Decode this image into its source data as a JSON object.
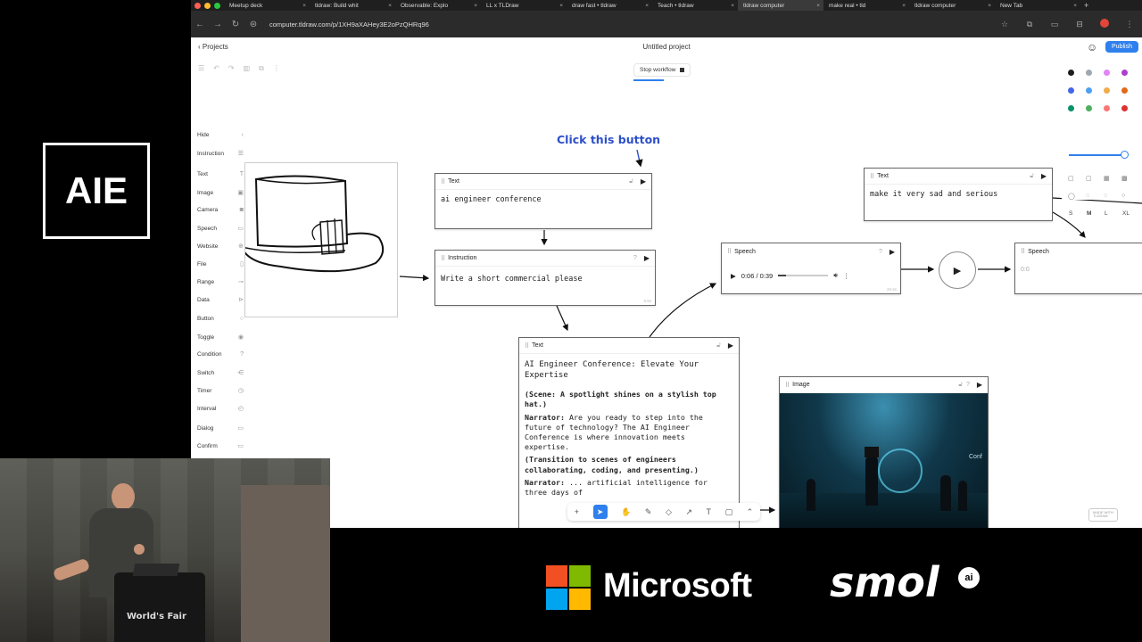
{
  "browser": {
    "tabs": [
      {
        "label": "Meetup deck",
        "active": false
      },
      {
        "label": "tldraw: Build whit",
        "active": false
      },
      {
        "label": "Observable: Explo",
        "active": false
      },
      {
        "label": "LL x TLDraw",
        "active": false
      },
      {
        "label": "draw fast • tldraw",
        "active": false
      },
      {
        "label": "Teach • tldraw",
        "active": false
      },
      {
        "label": "tldraw computer",
        "active": true
      },
      {
        "label": "make real • tld",
        "active": false
      },
      {
        "label": "tldraw computer",
        "active": false
      },
      {
        "label": "New Tab",
        "active": false
      }
    ],
    "new_tab_symbol": "+",
    "url": "computer.tldraw.com/p/1XH9aXAHey3E2oPzQHRq96"
  },
  "app": {
    "projects_label": "Projects",
    "title": "Untitled project",
    "publish_label": "Publish",
    "stop_workflow_label": "Stop workflow"
  },
  "sidebar": {
    "hide_label": "Hide",
    "items": [
      {
        "label": "Instruction",
        "icon": "list-icon",
        "glyph": "☰"
      },
      {
        "label": "Text",
        "icon": "text-icon",
        "glyph": "T"
      },
      {
        "label": "Image",
        "icon": "image-icon",
        "glyph": "▣"
      },
      {
        "label": "Camera",
        "icon": "camera-icon",
        "glyph": "◙"
      },
      {
        "label": "Speech",
        "icon": "speech-icon",
        "glyph": "▭"
      },
      {
        "label": "Website",
        "icon": "globe-icon",
        "glyph": "⊕"
      },
      {
        "label": "File",
        "icon": "file-icon",
        "glyph": "▯"
      },
      {
        "label": "Range",
        "icon": "range-icon",
        "glyph": "⊸"
      },
      {
        "label": "Data",
        "icon": "data-icon",
        "glyph": "⊳"
      },
      {
        "label": "Button",
        "icon": "button-icon",
        "glyph": "○"
      },
      {
        "label": "Toggle",
        "icon": "toggle-icon",
        "glyph": "◉"
      },
      {
        "label": "Condition",
        "icon": "condition-icon",
        "glyph": "?"
      },
      {
        "label": "Switch",
        "icon": "switch-icon",
        "glyph": "⋲"
      },
      {
        "label": "Timer",
        "icon": "timer-icon",
        "glyph": "◷"
      },
      {
        "label": "Interval",
        "icon": "interval-icon",
        "glyph": "◴"
      },
      {
        "label": "Dialog",
        "icon": "dialog-icon",
        "glyph": "▭"
      },
      {
        "label": "Confirm",
        "icon": "confirm-icon",
        "glyph": "▭"
      }
    ]
  },
  "canvas": {
    "annotation": "Click this button",
    "node_text_1": {
      "type": "Text",
      "content": "ai engineer conference"
    },
    "node_instruction": {
      "type": "Instruction",
      "content": "Write a short commercial please",
      "timing": "0.6s"
    },
    "node_text_output": {
      "type": "Text",
      "heading": "AI Engineer Conference: Elevate Your Expertise",
      "lines": [
        {
          "bold": "(Scene: A spotlight shines on a stylish top hat.)",
          "rest": ""
        },
        {
          "bold": "Narrator:",
          "rest": " Are you ready to step into the future of technology? The AI Engineer Conference is where innovation meets expertise."
        },
        {
          "bold": "(Transition to scenes of engineers collaborating, coding, and presenting.)",
          "rest": ""
        },
        {
          "bold": "Narrator:",
          "rest": " ... artificial intelligence for three days of"
        }
      ]
    },
    "node_speech_1": {
      "type": "Speech",
      "time": "0:06 / 0:39",
      "timing": "26.6s",
      "progress": 0.15
    },
    "node_text_2": {
      "type": "Text",
      "content": "make it very sad and serious"
    },
    "node_speech_2": {
      "type": "Speech",
      "time": "0:0"
    },
    "node_image": {
      "type": "Image",
      "image_text": "Conf"
    }
  },
  "style_panel": {
    "colors": [
      "#1d1d1d",
      "#9fa8b2",
      "#e085f4",
      "#ae3ec9",
      "#4465e9",
      "#4ba1f1",
      "#f1ac4b",
      "#e16919",
      "#099268",
      "#4cb05e",
      "#f87777",
      "#e03131"
    ],
    "sizes": [
      "S",
      "M",
      "L",
      "XL"
    ],
    "selected_size": "M"
  },
  "bottom_toolbar": {
    "tools": [
      {
        "name": "add-tool",
        "glyph": "+"
      },
      {
        "name": "select-tool",
        "glyph": "➤"
      },
      {
        "name": "hand-tool",
        "glyph": "✋"
      },
      {
        "name": "draw-tool",
        "glyph": "✎"
      },
      {
        "name": "eraser-tool",
        "glyph": "◇"
      },
      {
        "name": "arrow-tool",
        "glyph": "↗"
      },
      {
        "name": "text-tool",
        "glyph": "T"
      },
      {
        "name": "frame-tool",
        "glyph": "▢"
      },
      {
        "name": "more-tool",
        "glyph": "⌃"
      }
    ],
    "selected": "select-tool"
  },
  "made_with": [
    "MADE WITH",
    "TLDRAW"
  ],
  "overlay": {
    "event_logo": "AIE",
    "sponsor_1": "Microsoft",
    "sponsor_2": "smol",
    "sponsor_2_badge": "ai",
    "podium_text": "World's Fair",
    "ms_colors": [
      "#f25022",
      "#7fba00",
      "#00a4ef",
      "#ffb900"
    ]
  }
}
